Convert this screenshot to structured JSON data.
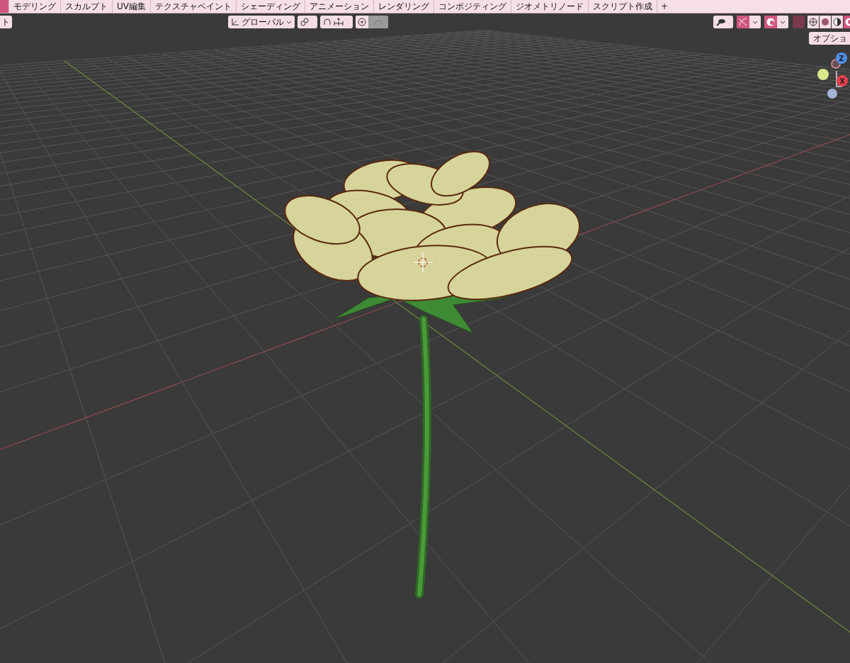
{
  "workspace_tabs": [
    {
      "selected": true
    },
    {
      "label": "モデリング",
      "selected": false
    },
    {
      "label": "スカルプト",
      "selected": false
    },
    {
      "label": "UV編集",
      "selected": false
    },
    {
      "label": "テクスチャペイント",
      "selected": false
    },
    {
      "label": "シェーディング",
      "selected": false
    },
    {
      "label": "アニメーション",
      "selected": false
    },
    {
      "label": "レンダリング",
      "selected": false
    },
    {
      "label": "コンポジティング",
      "selected": false
    },
    {
      "label": "ジオメトリノード",
      "selected": false
    },
    {
      "label": "スクリプト作成",
      "selected": false
    }
  ],
  "add_workspace": "+",
  "header": {
    "left_button": "ト",
    "orientation": "グローバル",
    "options": "オプショ",
    "proportional_edit": {
      "on": false
    },
    "gizmo_toggle": {
      "on": true
    },
    "overlays_toggle": {
      "on": true
    },
    "shading_modes": [
      {
        "kind": "wireframe",
        "selected": false
      },
      {
        "kind": "solid",
        "selected": false
      },
      {
        "kind": "material",
        "selected": false
      },
      {
        "kind": "rendered",
        "selected": true
      }
    ]
  },
  "gizmo": {
    "axes": [
      {
        "label": "Z",
        "color": "#4d8ee8"
      },
      {
        "label": "X",
        "color": "#e8404e"
      }
    ]
  }
}
